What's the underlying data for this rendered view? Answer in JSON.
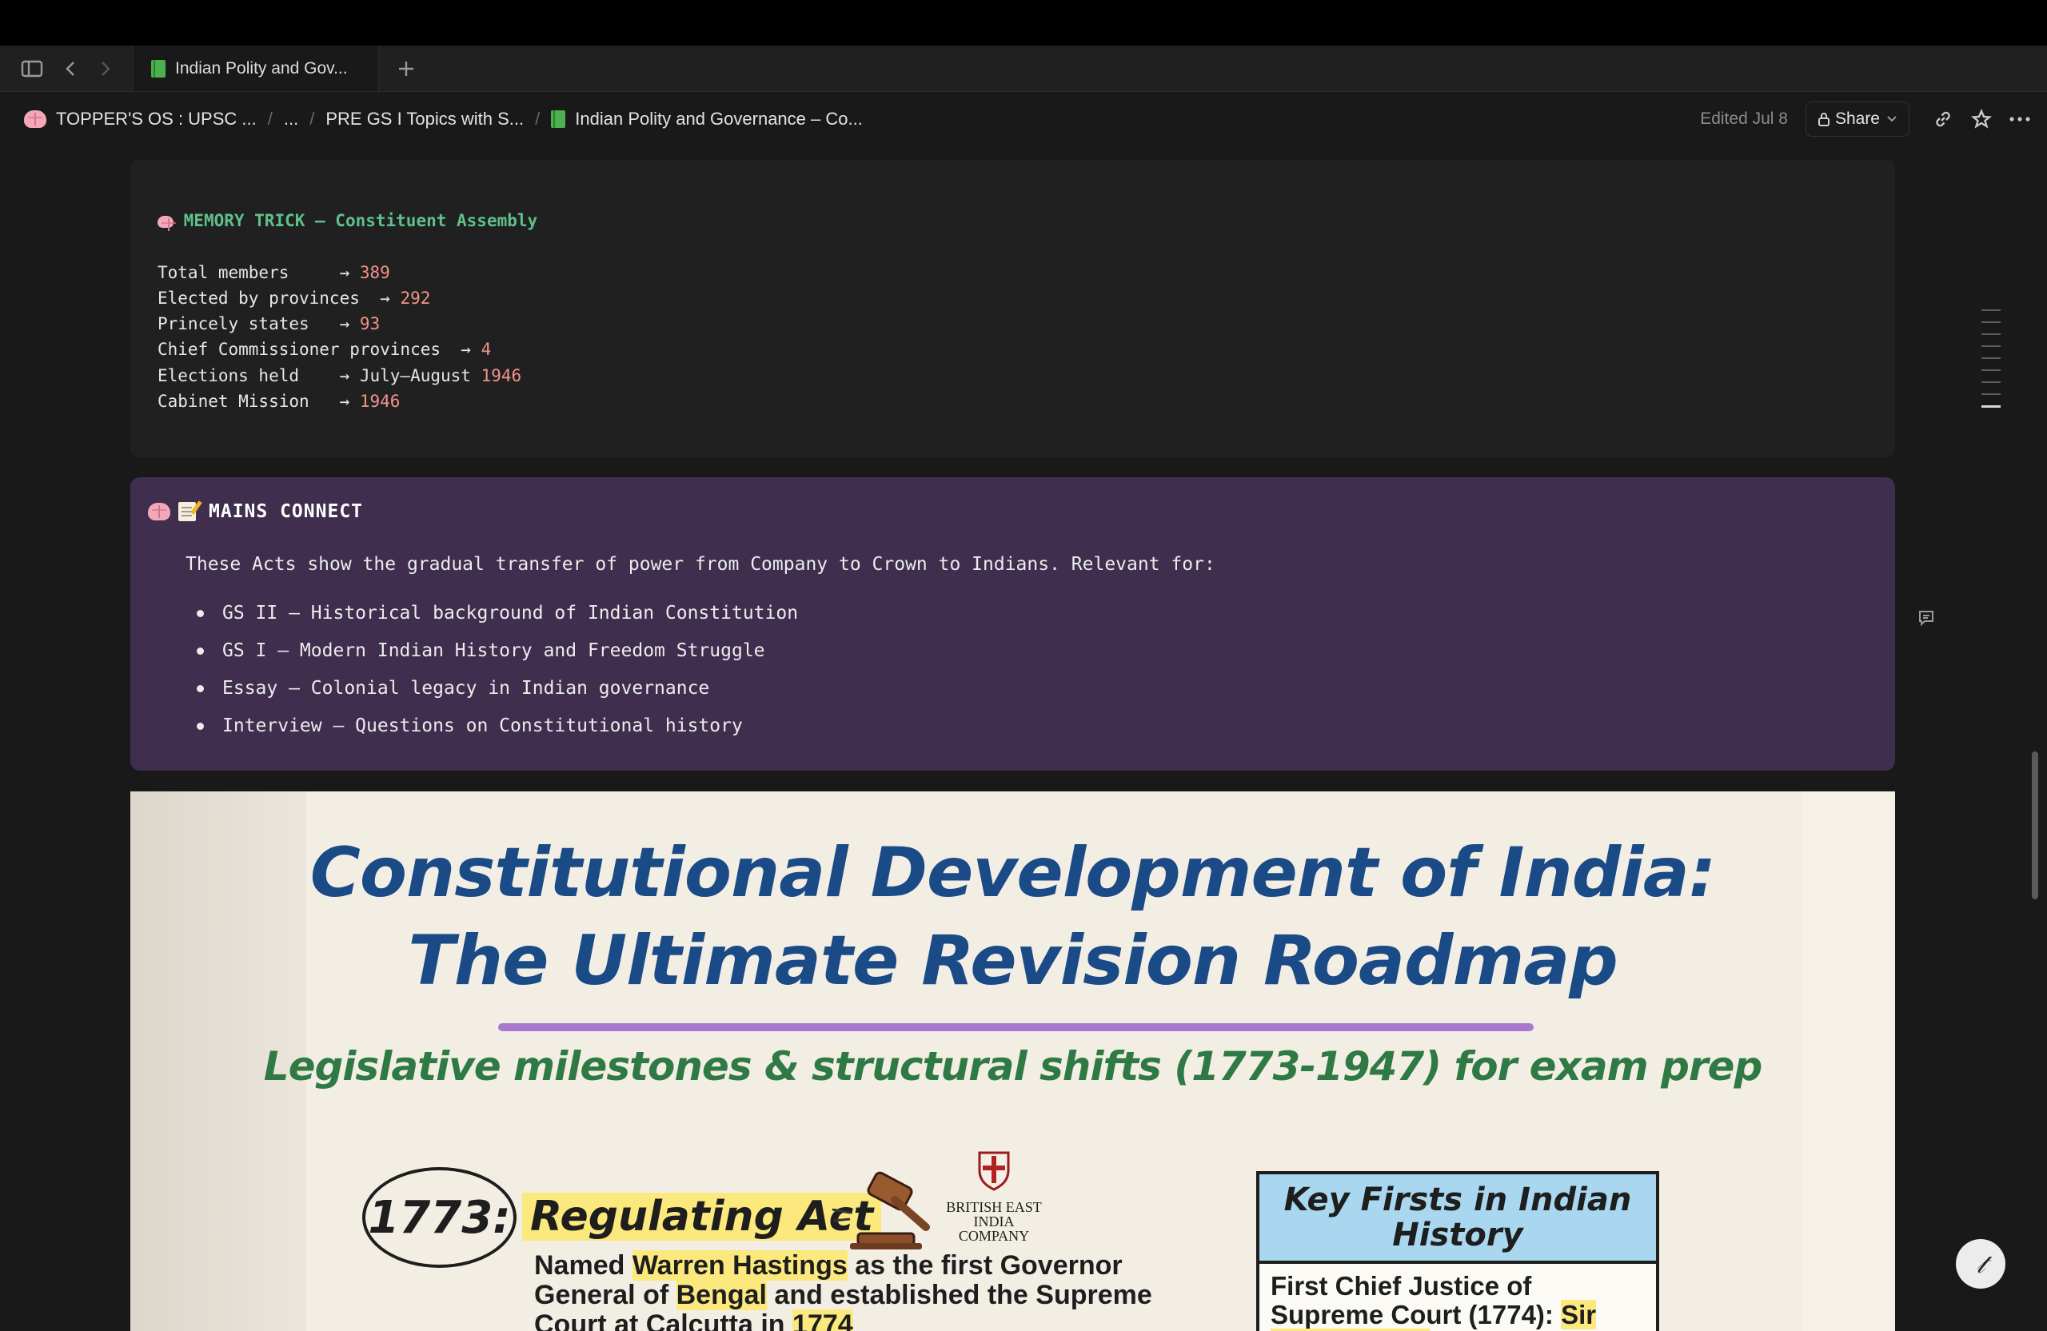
{
  "tab": {
    "title": "Indian Polity and Gov..."
  },
  "breadcrumb": {
    "root": "TOPPER'S OS : UPSC ...",
    "ellipsis": "...",
    "parent": "PRE GS I Topics with S...",
    "current": "Indian Polity and Governance – Co..."
  },
  "header": {
    "edited": "Edited Jul 8",
    "share_label": "Share"
  },
  "memory_trick": {
    "title": "MEMORY TRICK — Constituent Assembly",
    "rows": [
      {
        "pad": "Total members     → ",
        "val": "389",
        "tail": ""
      },
      {
        "pad": "Elected by provinces  → ",
        "val": "292",
        "tail": ""
      },
      {
        "pad": "Princely states   → ",
        "val": "93",
        "tail": ""
      },
      {
        "pad": "Chief Commissioner provinces  → ",
        "val": "4",
        "tail": ""
      },
      {
        "pad": "Elections held    → July–August ",
        "val": "1946",
        "tail": ""
      },
      {
        "pad": "Cabinet Mission   → ",
        "val": "1946",
        "tail": ""
      }
    ]
  },
  "mains_connect": {
    "title": "MAINS CONNECT",
    "text": "These Acts show the gradual transfer of power from Company to Crown to Indians. Relevant for:",
    "items": [
      "GS II — Historical background of Indian Constitution",
      "GS I — Modern Indian History and Freedom Struggle",
      "Essay — Colonial legacy in Indian governance",
      "Interview — Questions on Constitutional history"
    ]
  },
  "infographic": {
    "title_line1": "Constitutional Development of India:",
    "title_line2": "The Ultimate Revision Roadmap",
    "subtitle": "Legislative milestones & structural shifts (1773-1947) for exam prep",
    "year": "1773:",
    "act_title": "Regulating Act",
    "desc_1": "Named ",
    "desc_hl_1": "Warren Hastings",
    "desc_2": " as the first Governor General of ",
    "desc_hl_2": "Bengal",
    "desc_3": " and established the Supreme Court at Calcutta in ",
    "desc_hl_3": "1774",
    "company": "BRITISH EAST INDIA COMPANY",
    "key_box_title": "Key Firsts in Indian History",
    "key_box_text": "First Chief Justice of Supreme Court (1774): ",
    "key_box_hl": "Sir Elijah Impey."
  },
  "colors": {
    "callout_bg": "#3f2e4e",
    "code_title": "#5ec08a",
    "numbers": "#f2938a",
    "title_blue": "#1b4b86",
    "sub_green": "#2f7a44"
  }
}
